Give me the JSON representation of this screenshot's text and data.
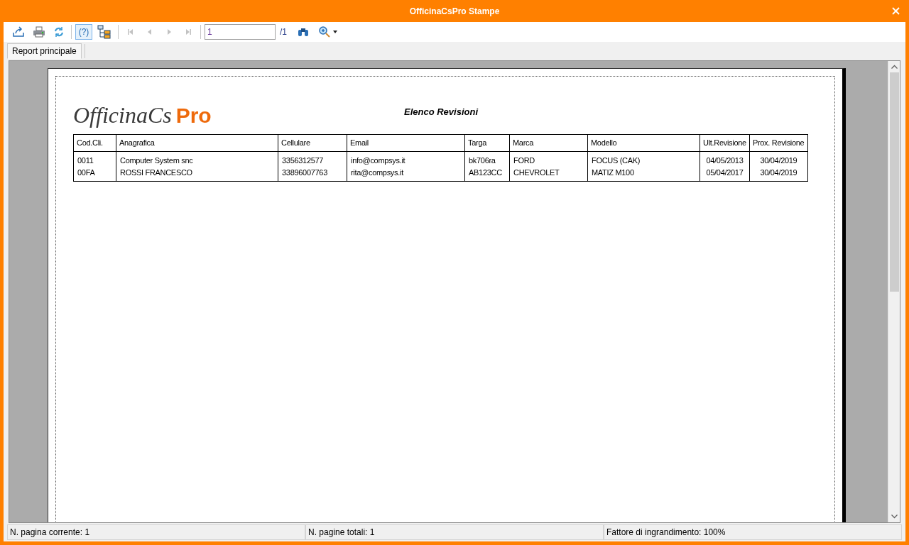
{
  "window": {
    "title": "OfficinaCsPro Stampe"
  },
  "toolbar": {
    "buttons": [
      {
        "kind": "export",
        "selected": false,
        "disabled": false
      },
      {
        "kind": "print",
        "selected": false,
        "disabled": false
      },
      {
        "kind": "refresh",
        "selected": false,
        "disabled": false
      },
      {
        "kind": "help",
        "selected": true,
        "disabled": false,
        "label": "(?)"
      },
      {
        "kind": "tree",
        "selected": false,
        "disabled": false
      },
      {
        "kind": "first",
        "selected": false,
        "disabled": true
      },
      {
        "kind": "prev",
        "selected": false,
        "disabled": true
      },
      {
        "kind": "next",
        "selected": false,
        "disabled": true
      },
      {
        "kind": "last",
        "selected": false,
        "disabled": true
      }
    ],
    "page_field": {
      "value": "1"
    },
    "page_total": "/1"
  },
  "tabs": [
    {
      "label": "Report principale",
      "selected": true
    }
  ],
  "report": {
    "logo": {
      "main": "OfficinaCs",
      "accent": "Pro"
    },
    "title": "Elenco Revisioni",
    "columns": [
      "Cod.Cli.",
      "Anagrafica",
      "Cellulare",
      "Email",
      "Targa",
      "Marca",
      "Modello",
      "Ult.Revisione",
      "Prox. Revisione"
    ],
    "rows": [
      [
        "0011",
        "Computer System snc",
        "3356312577",
        "info@compsys.it",
        "bk706ra",
        "FORD",
        "FOCUS (CAK)",
        "04/05/2013",
        "30/04/2019"
      ],
      [
        "00FA",
        "ROSSI FRANCESCO",
        "33896007763",
        "rita@compsys.it",
        "AB123CC",
        "CHEVROLET",
        "MATIZ M100",
        "05/04/2017",
        "30/04/2019"
      ]
    ]
  },
  "status_bar": [
    "N. pagina corrente: 1",
    "N. pagine totali: 1",
    "Fattore di ingrandimento: 100%"
  ]
}
